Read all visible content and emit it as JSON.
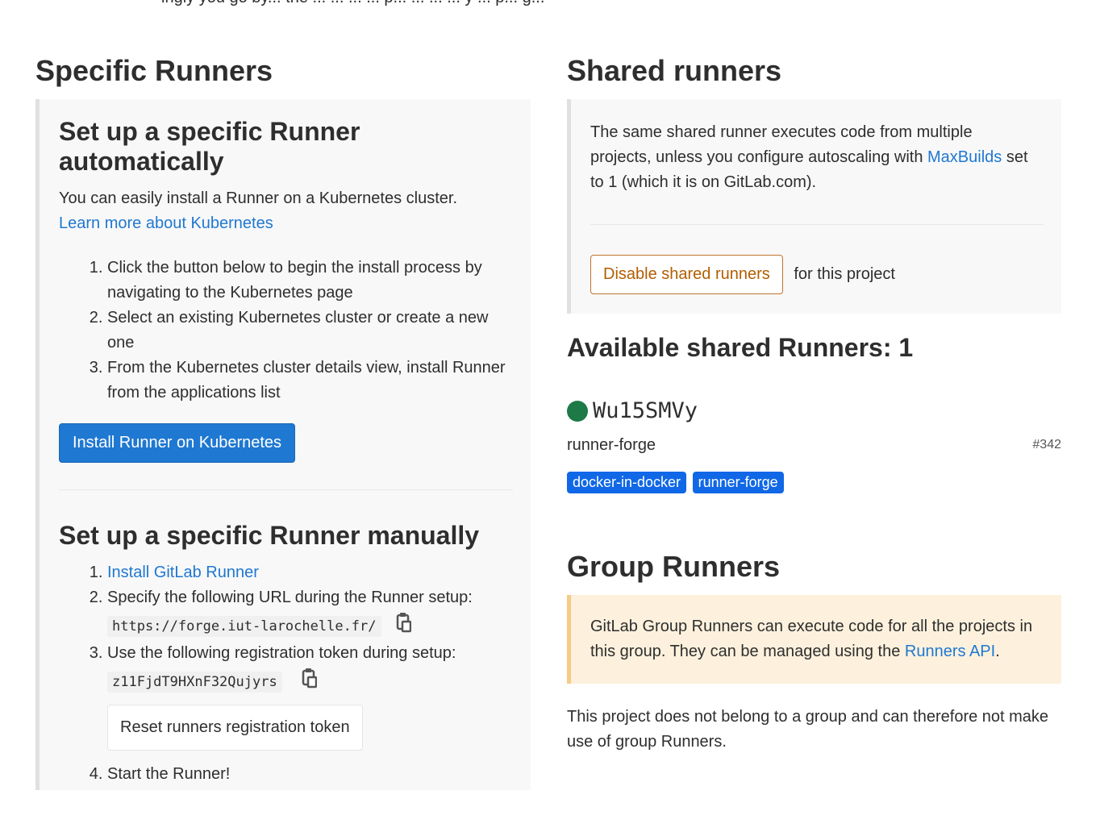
{
  "top_clipped_text": "ingly you go by... the ... ... ... ... p... ... ... ... y ... p... g...",
  "specific": {
    "title": "Specific Runners",
    "auto": {
      "title": "Set up a specific Runner automatically",
      "description": "You can easily install a Runner on a Kubernetes cluster.",
      "learn_more": "Learn more about Kubernetes",
      "steps": [
        "Click the button below to begin the install process by navigating to the Kubernetes page",
        "Select an existing Kubernetes cluster or create a new one",
        "From the Kubernetes cluster details view, install Runner from the applications list"
      ],
      "install_button": "Install Runner on Kubernetes"
    },
    "manual": {
      "title": "Set up a specific Runner manually",
      "step1_link": "Install GitLab Runner",
      "step2_text": "Specify the following URL during the Runner setup:",
      "url": "https://forge.iut-larochelle.fr/",
      "step3_text": "Use the following registration token during setup:",
      "token": "z11FjdT9HXnF32Qujyrs",
      "reset_button": "Reset runners registration token",
      "step4_text": "Start the Runner!"
    }
  },
  "shared": {
    "title": "Shared runners",
    "description_part1": "The same shared runner executes code from multiple projects, unless you configure autoscaling with ",
    "maxbuilds_link": "MaxBuilds",
    "description_part2": " set to 1 (which it is on GitLab.com).",
    "disable_button": "Disable shared runners",
    "for_project": "for this project",
    "available_title": "Available shared Runners: 1",
    "runner": {
      "token": "Wu15SMVy",
      "description": "runner-forge",
      "id": "#342",
      "tags": [
        "docker-in-docker",
        "runner-forge"
      ],
      "status_color": "#1d7a47"
    }
  },
  "group": {
    "title": "Group Runners",
    "info_part1": "GitLab Group Runners can execute code for all the projects in this group. They can be managed using the ",
    "api_link": "Runners API",
    "info_part2": ".",
    "no_group_text": "This project does not belong to a group and can therefore not make use of group Runners."
  },
  "colors": {
    "link": "#1f78d1",
    "primary_button": "#1f78d1",
    "warning_outline": "#c2742a",
    "badge": "#1068e6",
    "warning_bg": "#fdf1dd"
  }
}
